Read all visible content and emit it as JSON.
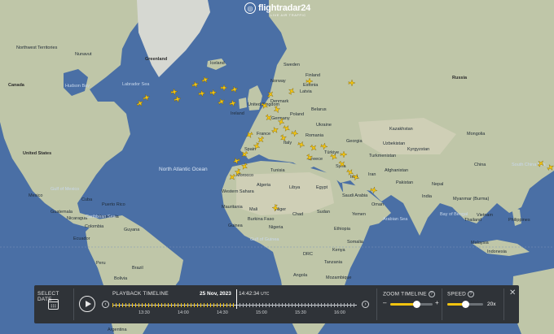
{
  "brand": {
    "name": "flightradar24",
    "tagline": "LIVE AIR TRAFFIC"
  },
  "colors": {
    "accent": "#f3c40f",
    "panel": "#2f3338",
    "ocean": "#4a6fa5",
    "land": "#bfc6a8"
  },
  "map": {
    "countries": [
      "Greenland",
      "Iceland",
      "Canada",
      "Sweden",
      "Finland",
      "Norway",
      "Russia",
      "Estonia",
      "Latvia",
      "Denmark",
      "United Kingdom",
      "Ireland",
      "Belarus",
      "Poland",
      "Germany",
      "Ukraine",
      "France",
      "Kazakhstan",
      "Mongolia",
      "Romania",
      "Italy",
      "Spain",
      "Georgia",
      "Uzbekistan",
      "Kyrgyzstan",
      "Türkiye",
      "Turkmenistan",
      "Greece",
      "Tunisia",
      "Syria",
      "China",
      "Iran",
      "Afghanistan",
      "Morocco",
      "Iraq",
      "Algeria",
      "Libya",
      "Egypt",
      "Pakistan",
      "Nepal",
      "Western Sahara",
      "Saudi Arabia",
      "India",
      "Myanmar (Burma)",
      "Oman",
      "Mauritania",
      "Mali",
      "Niger",
      "Chad",
      "Sudan",
      "Yemen",
      "Thailand",
      "Philippines",
      "Burkina Faso",
      "Nigeria",
      "Vietnam",
      "Ethiopia",
      "Guinea",
      "Somalia",
      "Malaysia",
      "DRC",
      "Kenya",
      "Tanzania",
      "Angola",
      "Mozambique",
      "Indonesia",
      "Brazil",
      "Peru",
      "Bolivia",
      "Argentina",
      "Venezuela",
      "Colombia",
      "Ecuador",
      "Mexico",
      "Cuba",
      "Puerto Rico",
      "Guatemala",
      "Nicaragua",
      "Guyana",
      "United States"
    ],
    "regions": [
      "Northwest Territories",
      "Nunavut",
      "Hudson Bay",
      "Labrador Sea",
      "Gulf of Mexico",
      "Caribbean Sea",
      "Arabian Sea",
      "Bay of Bengal",
      "South China Sea",
      "Gulf of Guinea",
      "North Atlantic Ocean"
    ]
  },
  "playback": {
    "select_date_label": "SELECT DATE",
    "timeline_label": "PLAYBACK TIMELINE",
    "date": "25 Nov, 2023",
    "time": "14:42:34",
    "tz": "UTC",
    "progress": 0.505,
    "ticks": [
      "13:30",
      "14:00",
      "14:30",
      "15:00",
      "15:30",
      "16:00"
    ],
    "prev": "‹",
    "next": "›"
  },
  "zoom": {
    "label": "ZOOM TIMELINE",
    "minus": "–",
    "plus": "+",
    "value": 0.62
  },
  "speed": {
    "label": "SPEED",
    "value_label": "20x",
    "value": 0.5
  },
  "help_glyph": "?",
  "close_glyph": "✕"
}
